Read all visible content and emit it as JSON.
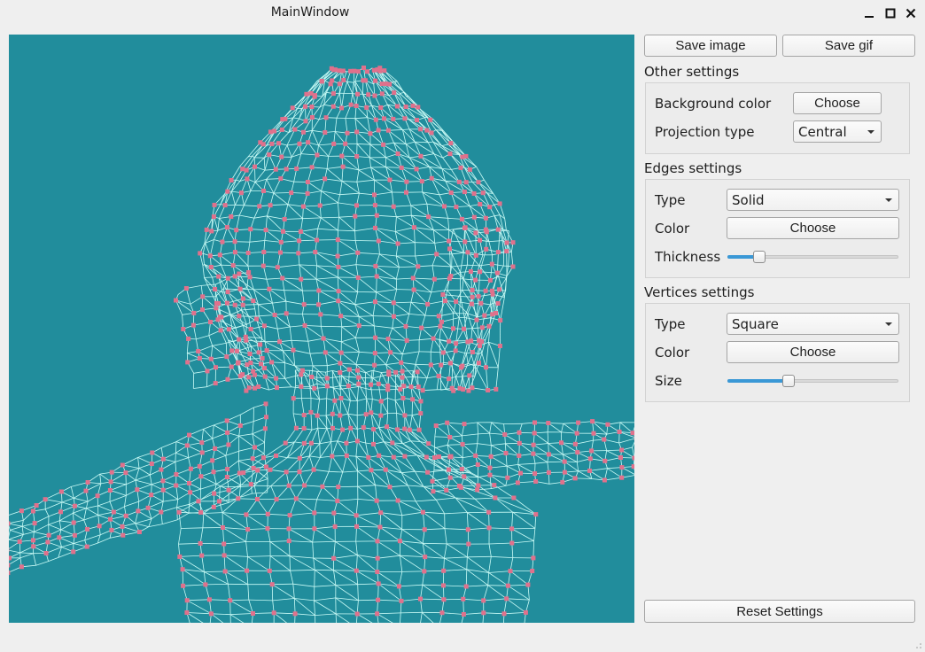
{
  "window": {
    "title": "MainWindow"
  },
  "viewport": {
    "background_color": "#218d9c",
    "edge_color": "#c9fbf6",
    "vertex_color": "#e0718c"
  },
  "toolbar": {
    "save_image_label": "Save image",
    "save_gif_label": "Save gif"
  },
  "other_settings": {
    "title": "Other settings",
    "background_color_label": "Background color",
    "background_color_button": "Choose",
    "projection_type_label": "Projection type",
    "projection_type_value": "Central"
  },
  "edges_settings": {
    "title": "Edges settings",
    "type_label": "Type",
    "type_value": "Solid",
    "color_label": "Color",
    "color_button": "Choose",
    "thickness_label": "Thickness",
    "thickness_fraction": 0.16
  },
  "vertices_settings": {
    "title": "Vertices settings",
    "type_label": "Type",
    "type_value": "Square",
    "color_label": "Color",
    "color_button": "Choose",
    "size_label": "Size",
    "size_fraction": 0.34
  },
  "reset_label": "Reset Settings",
  "icons": {
    "minimize": "minimize-icon",
    "maximize": "maximize-icon",
    "close": "close-icon",
    "dropdown": "chevron-down-icon",
    "resize": "resize-grip-icon"
  }
}
